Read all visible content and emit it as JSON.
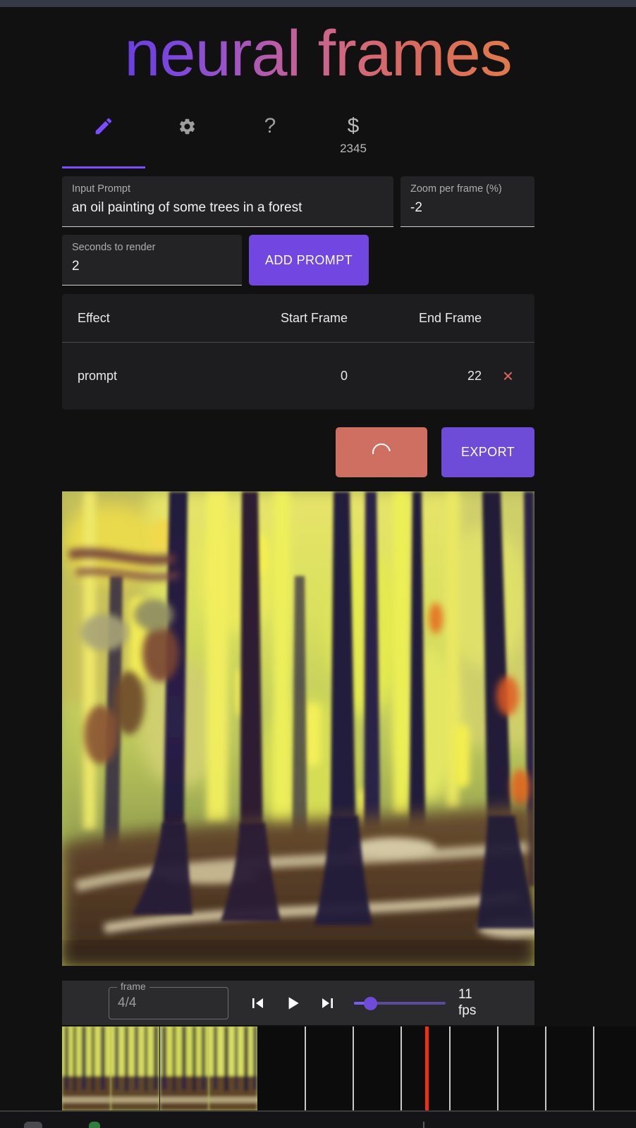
{
  "brand": {
    "title": "neural frames"
  },
  "tabs": [
    {
      "name": "editor",
      "icon": "pencil-icon",
      "label": "",
      "active": true
    },
    {
      "name": "settings",
      "icon": "gear-icon",
      "label": "",
      "active": false
    },
    {
      "name": "help",
      "icon": "question-mark-icon",
      "label": "?",
      "active": false
    },
    {
      "name": "credits",
      "icon": "dollar-icon",
      "label": "$",
      "credits": "2345",
      "active": false
    }
  ],
  "form": {
    "prompt": {
      "label": "Input Prompt",
      "value": "an oil painting of some trees in a forest"
    },
    "zoom": {
      "label": "Zoom per frame (%)",
      "value": "-2"
    },
    "seconds": {
      "label": "Seconds to render",
      "value": "2"
    },
    "add_prompt_label": "ADD PROMPT"
  },
  "effects_table": {
    "columns": [
      "Effect",
      "Start Frame",
      "End Frame"
    ],
    "rows": [
      {
        "effect": "prompt",
        "start_frame": "0",
        "end_frame": "22",
        "delete_glyph": "×"
      }
    ]
  },
  "actions": {
    "render_label": "",
    "render_state": "loading",
    "export_label": "EXPORT"
  },
  "playback": {
    "frame_label": "frame",
    "frame_value": "4/4",
    "skip_start_glyph": "skip-to-start",
    "play_glyph": "play",
    "skip_end_glyph": "skip-to-end",
    "fps_value": "11",
    "fps_unit": "fps"
  },
  "colors": {
    "accent_purple": "#7c4dff",
    "button_purple": "#6f4cd8",
    "render_salmon": "#cf6f62",
    "delete_red": "#e06a5e",
    "playhead_red": "#f22d14",
    "panel_bg": "#1d1d1f",
    "field_bg": "#232325",
    "page_bg": "#111112"
  }
}
